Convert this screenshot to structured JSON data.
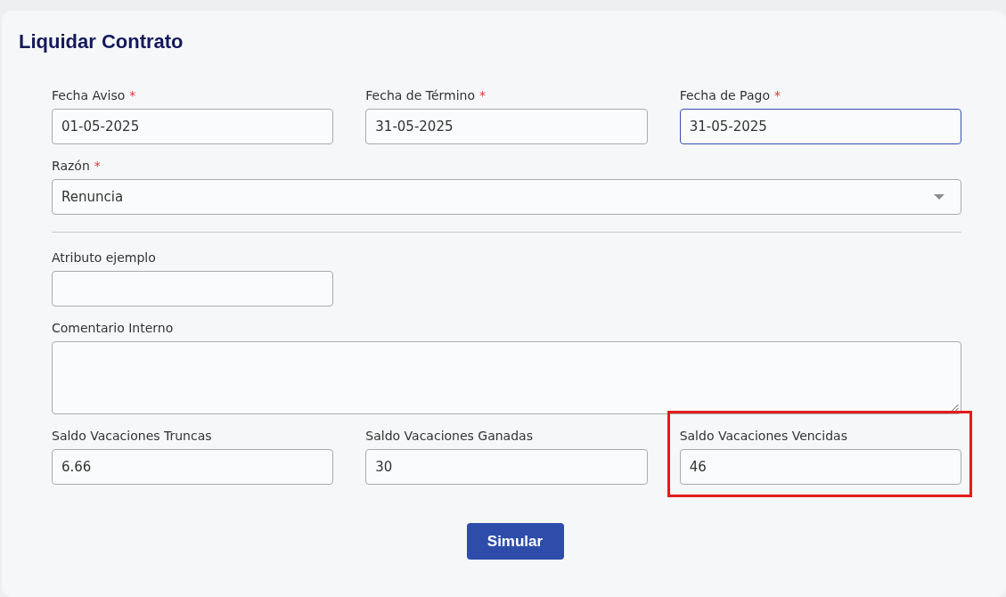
{
  "title": "Liquidar Contrato",
  "sections": [
    {
      "rows": [
        {
          "fields": [
            {
              "kind": "input",
              "label": "Fecha Aviso",
              "required_mark": "*",
              "value": "01-05-2025",
              "focused": false
            },
            {
              "kind": "input",
              "label": "Fecha de Término",
              "required_mark": "*",
              "value": "31-05-2025",
              "focused": false
            },
            {
              "kind": "input",
              "label": "Fecha de Pago",
              "required_mark": "*",
              "value": "31-05-2025",
              "focused": true
            }
          ]
        },
        {
          "fields": [
            {
              "kind": "select",
              "label": "Razón",
              "required_mark": "*",
              "value": "Renuncia",
              "focused": false
            }
          ]
        }
      ]
    },
    {
      "rows": [
        {
          "fields": [
            {
              "kind": "input",
              "label": "Atributo ejemplo",
              "focused": false
            }
          ]
        },
        {
          "fields": [
            {
              "kind": "textarea",
              "label": "Comentario Interno",
              "focused": false
            }
          ]
        },
        {
          "fields": [
            {
              "kind": "input",
              "label": "Saldo Vacaciones Truncas",
              "value": "6.66",
              "focused": false
            },
            {
              "kind": "input",
              "label": "Saldo Vacaciones Ganadas",
              "value": "30",
              "focused": false
            },
            {
              "kind": "input",
              "label": "Saldo Vacaciones Vencidas",
              "value": "46",
              "focused": false,
              "highlighted": true
            }
          ]
        }
      ]
    }
  ],
  "button": "Simular"
}
